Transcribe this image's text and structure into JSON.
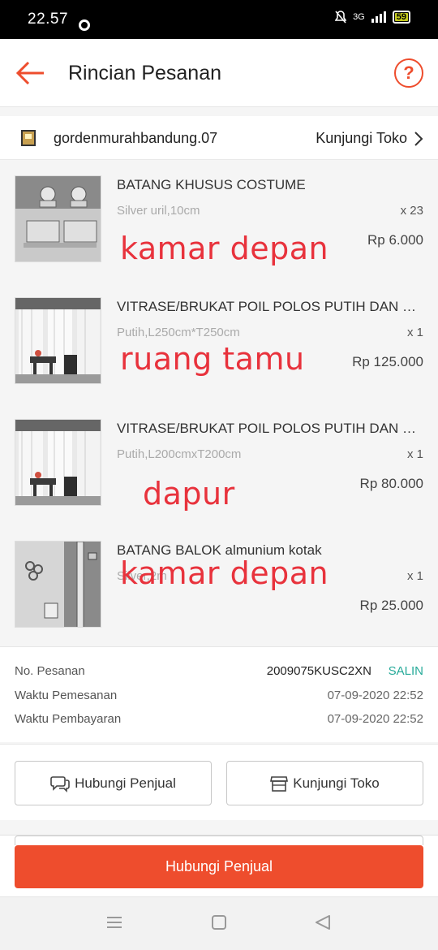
{
  "status_bar": {
    "time": "22.57",
    "network": "3G",
    "battery": "59"
  },
  "header": {
    "title": "Rincian Pesanan",
    "back_icon": "arrow-left-icon",
    "help_icon": "question-circle-icon"
  },
  "shop": {
    "name": "gordenmurahbandung.07",
    "visit_label": "Kunjungi Toko"
  },
  "products": [
    {
      "name": "BATANG KHUSUS COSTUME",
      "variant": "Silver uril,10cm",
      "qty": "x 23",
      "price": "Rp 6.000",
      "note": "kamar depan"
    },
    {
      "name": "VITRASE/BRUKAT POIL POLOS PUTIH DAN …",
      "variant": "Putih,L250cm*T250cm",
      "qty": "x 1",
      "price": "Rp 125.000",
      "note": "ruang tamu"
    },
    {
      "name": "VITRASE/BRUKAT POIL POLOS PUTIH DAN …",
      "variant": "Putih,L200cmxT200cm",
      "qty": "x 1",
      "price": "Rp 80.000",
      "note": "dapur"
    },
    {
      "name": "BATANG BALOK almunium kotak",
      "variant": "Silver,2m",
      "qty": "x 1",
      "price": "Rp 25.000",
      "note": "kamar depan"
    }
  ],
  "order": {
    "number_label": "No. Pesanan",
    "number_value": "2009075KUSC2XN",
    "copy_label": "SALIN",
    "order_time_label": "Waktu Pemesanan",
    "order_time_value": "07-09-2020 22:52",
    "payment_time_label": "Waktu Pembayaran",
    "payment_time_value": "07-09-2020 22:52"
  },
  "actions": {
    "contact_seller": "Hubungi Penjual",
    "visit_shop": "Kunjungi Toko"
  },
  "bottom": {
    "primary_label": "Hubungi Penjual"
  },
  "colors": {
    "accent": "#ee4d2d",
    "copy": "#26aa99",
    "note": "#e8323c"
  }
}
